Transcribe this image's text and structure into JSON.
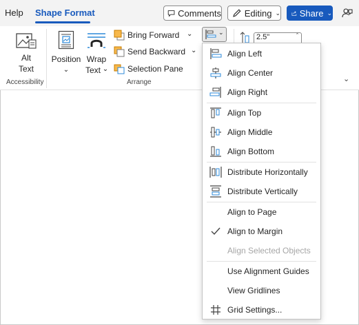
{
  "tabs": {
    "help": "Help",
    "shape_format": "Shape Format"
  },
  "header_buttons": {
    "comments": "Comments",
    "editing": "Editing",
    "share": "Share"
  },
  "ribbon": {
    "alt_text": {
      "line1": "Alt",
      "line2": "Text"
    },
    "position_label": "Position",
    "wrap_text": {
      "line1": "Wrap",
      "line2": "Text"
    },
    "bring_forward": "Bring Forward",
    "send_backward": "Send Backward",
    "selection_pane": "Selection Pane",
    "size_value": "2.5\"",
    "groups": {
      "accessibility": "Accessibility",
      "arrange": "Arrange"
    }
  },
  "align_menu": {
    "items": [
      {
        "label": "Align Left",
        "icon": "align-left-icon"
      },
      {
        "label": "Align Center",
        "icon": "align-center-icon"
      },
      {
        "label": "Align Right",
        "icon": "align-right-icon"
      },
      {
        "label": "Align Top",
        "icon": "align-top-icon"
      },
      {
        "label": "Align Middle",
        "icon": "align-middle-icon"
      },
      {
        "label": "Align Bottom",
        "icon": "align-bottom-icon"
      },
      {
        "label": "Distribute Horizontally",
        "icon": "distribute-horizontally-icon"
      },
      {
        "label": "Distribute Vertically",
        "icon": "distribute-vertically-icon"
      },
      {
        "label": "Align to Page",
        "icon": ""
      },
      {
        "label": "Align to Margin",
        "icon": "checkmark-icon",
        "checked": true
      },
      {
        "label": "Align Selected Objects",
        "icon": "",
        "disabled": true
      },
      {
        "label": "Use Alignment Guides",
        "icon": ""
      },
      {
        "label": "View Gridlines",
        "icon": ""
      },
      {
        "label": "Grid Settings...",
        "icon": "grid-icon"
      }
    ]
  },
  "colors": {
    "accent": "#185abd",
    "disabled_text": "#a6a6a6",
    "icon_blue": "#2b88d8"
  }
}
